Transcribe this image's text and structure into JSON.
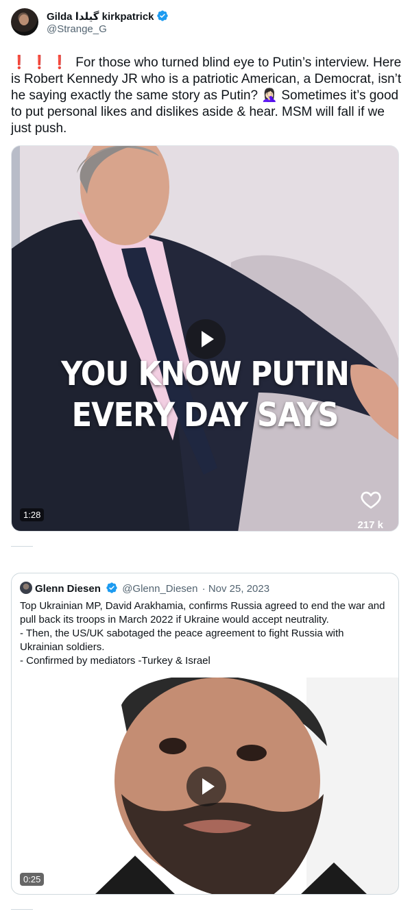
{
  "tweet": {
    "author_name": "Gilda گیلدا kirkpatrick",
    "handle": "@Strange_G",
    "exclamations": "❗❗❗",
    "text": "For those who turned blind eye to Putin’s interview. Here is Robert Kennedy JR who is a patriotic American, a Democrat, isn’t he saying exactly the same story as Putin? 🤦🏻‍♀️ Sometimes it’s good to put personal likes and dislikes aside & hear. MSM will fall if we just push.",
    "video": {
      "caption_line1": "YOU KNOW PUTIN",
      "caption_line2": "EVERY DAY SAYS",
      "duration": "1:28",
      "likes": "217 k"
    }
  },
  "quote": {
    "author_name": "Glenn Diesen",
    "handle": "@Glenn_Diesen",
    "date": "· Nov 25, 2023",
    "lines": [
      "Top Ukrainian MP, David Arakhamia, confirms Russia agreed to end the war and pull back its troops in March 2022 if Ukraine would accept neutrality.",
      "- Then, the US/UK sabotaged the peace agreement to fight Russia with Ukrainian soldiers.",
      "- Confirmed by mediators -Turkey & Israel"
    ],
    "video": {
      "duration": "0:25"
    }
  },
  "colors": {
    "verified": "#1d9bf0",
    "text": "#0f1419",
    "secondary": "#536471",
    "border": "#cfd9de"
  }
}
